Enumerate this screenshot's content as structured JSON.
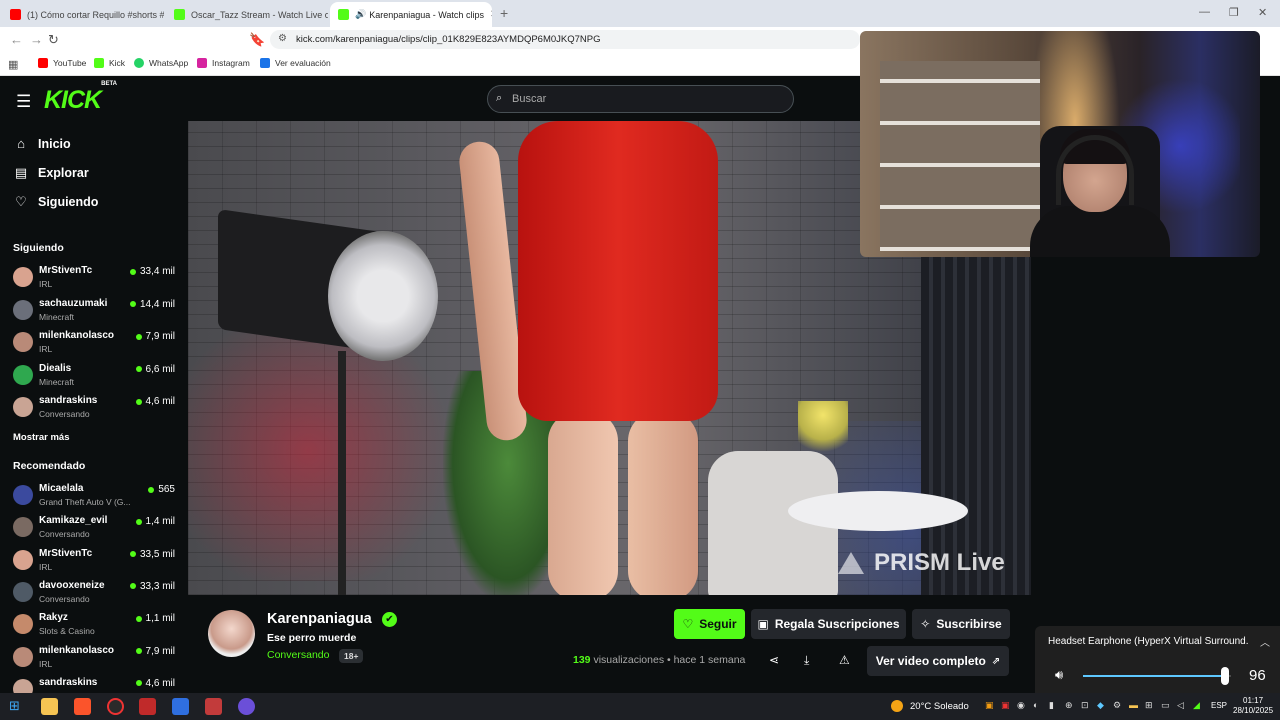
{
  "browser": {
    "tabs": [
      {
        "title": "(1) Cómo cortar Requillo #shorts #b",
        "icon_color": "#ff0000"
      },
      {
        "title": "Oscar_Tazz Stream - Watch Live on K",
        "icon_color": "#53fc18"
      },
      {
        "title": "Karenpaniagua - Watch clips",
        "icon_color": "#53fc18"
      }
    ],
    "url": "kick.com/karenpaniagua/clips/clip_01K829E823AYMDQP6M0JKQ7NPG",
    "bookmarks": [
      {
        "label": "YouTube",
        "icon_color": "#ff0000"
      },
      {
        "label": "Kick",
        "icon_color": "#53fc18"
      },
      {
        "label": "WhatsApp",
        "icon_color": "#25d366"
      },
      {
        "label": "Instagram",
        "icon_color": "#d6249f"
      },
      {
        "label": "Ver evaluación",
        "icon_color": "#1a73e8"
      }
    ]
  },
  "kick": {
    "logo": "KICK",
    "logo_badge": "BETA",
    "search_placeholder": "Buscar",
    "nav": [
      {
        "label": "Inicio",
        "icon": "home-icon"
      },
      {
        "label": "Explorar",
        "icon": "compass-icon"
      },
      {
        "label": "Siguiendo",
        "icon": "heart-icon"
      }
    ],
    "following_title": "Siguiendo",
    "following": [
      {
        "name": "MrStivenTc",
        "category": "IRL",
        "viewers": "33,4 mil",
        "avatar_color": "#d9a38f"
      },
      {
        "name": "sachauzumaki",
        "category": "Minecraft",
        "viewers": "14,4 mil",
        "avatar_color": "#6b6f7a"
      },
      {
        "name": "milenkanolasco",
        "category": "IRL",
        "viewers": "7,9 mil",
        "avatar_color": "#b98a78"
      },
      {
        "name": "Diealis",
        "category": "Minecraft",
        "viewers": "6,6 mil",
        "avatar_color": "#2fa84f"
      },
      {
        "name": "sandraskins",
        "category": "Conversando",
        "viewers": "4,6 mil",
        "avatar_color": "#c9a494"
      }
    ],
    "show_more": "Mostrar más",
    "recommended_title": "Recomendado",
    "recommended": [
      {
        "name": "Micaelala",
        "category": "Grand Theft Auto V (G...",
        "viewers": "565",
        "avatar_color": "#3b4a9e"
      },
      {
        "name": "Kamikaze_evil",
        "category": "Conversando",
        "viewers": "1,4 mil",
        "avatar_color": "#7a6a62"
      },
      {
        "name": "MrStivenTc",
        "category": "IRL",
        "viewers": "33,5 mil",
        "avatar_color": "#d9a38f"
      },
      {
        "name": "davooxeneize",
        "category": "Conversando",
        "viewers": "33,3 mil",
        "avatar_color": "#4f5a66"
      },
      {
        "name": "Rakyz",
        "category": "Slots & Casino",
        "viewers": "1,1 mil",
        "avatar_color": "#c58a6b"
      },
      {
        "name": "milenkanolasco",
        "category": "IRL",
        "viewers": "7,9 mil",
        "avatar_color": "#b98a78"
      },
      {
        "name": "sandraskins",
        "category": "",
        "viewers": "4,6 mil",
        "avatar_color": "#c9a494"
      }
    ]
  },
  "video": {
    "watermark": "PRISM Live"
  },
  "clip": {
    "streamer": "Karenpaniagua",
    "verified_mark": "✔",
    "title": "Ese perro muerde",
    "category": "Conversando",
    "age_badge": "18+",
    "follow_label": "Seguir",
    "gift_label": "Regala Suscripciones",
    "subscribe_label": "Suscribirse",
    "views_count": "139",
    "views_label": "visualizaciones",
    "time_ago": "• hace 1 semana",
    "full_video_label": "Ver video completo"
  },
  "volume": {
    "device": "Headset Earphone (HyperX Virtual Surround...",
    "level": 96,
    "level_text": "96",
    "accent": "#5ec8ff"
  },
  "taskbar": {
    "weather": "20°C Soleado",
    "language": "ESP",
    "time": "01:17",
    "date": "28/10/2025"
  }
}
